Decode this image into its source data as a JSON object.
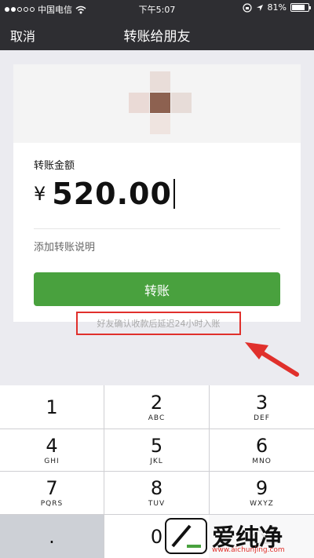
{
  "status_bar": {
    "carrier": "中国电信",
    "time": "下午5:07",
    "battery_percent": "81%",
    "battery_level": 0.81,
    "signal_bars_filled": 2,
    "signal_bars_total": 5
  },
  "nav": {
    "back_label": "取消",
    "title": "转账给朋友"
  },
  "transfer": {
    "amount_label": "转账金额",
    "currency_symbol": "¥",
    "amount": "520.00",
    "add_note_label": "添加转账说明",
    "button_label": "转账",
    "hint": "好友确认收款后延迟24小时入账"
  },
  "keypad": {
    "keys": [
      {
        "digit": "1",
        "letters": ""
      },
      {
        "digit": "2",
        "letters": "ABC"
      },
      {
        "digit": "3",
        "letters": "DEF"
      },
      {
        "digit": "4",
        "letters": "GHI"
      },
      {
        "digit": "5",
        "letters": "JKL"
      },
      {
        "digit": "6",
        "letters": "MNO"
      },
      {
        "digit": "7",
        "letters": "PQRS"
      },
      {
        "digit": "8",
        "letters": "TUV"
      },
      {
        "digit": "9",
        "letters": "WXYZ"
      },
      {
        "digit": ".",
        "letters": ""
      },
      {
        "digit": "0",
        "letters": ""
      }
    ]
  },
  "watermark": {
    "text": "爱纯净",
    "url": "www.aichunjing.com"
  },
  "colors": {
    "nav_bg": "#2e2e32",
    "accent_green": "#49a13e",
    "highlight_red": "#e0302c"
  },
  "icons": [
    "wifi-icon",
    "lock-rotation-icon",
    "location-icon",
    "battery-icon",
    "red-arrow-annotation"
  ]
}
